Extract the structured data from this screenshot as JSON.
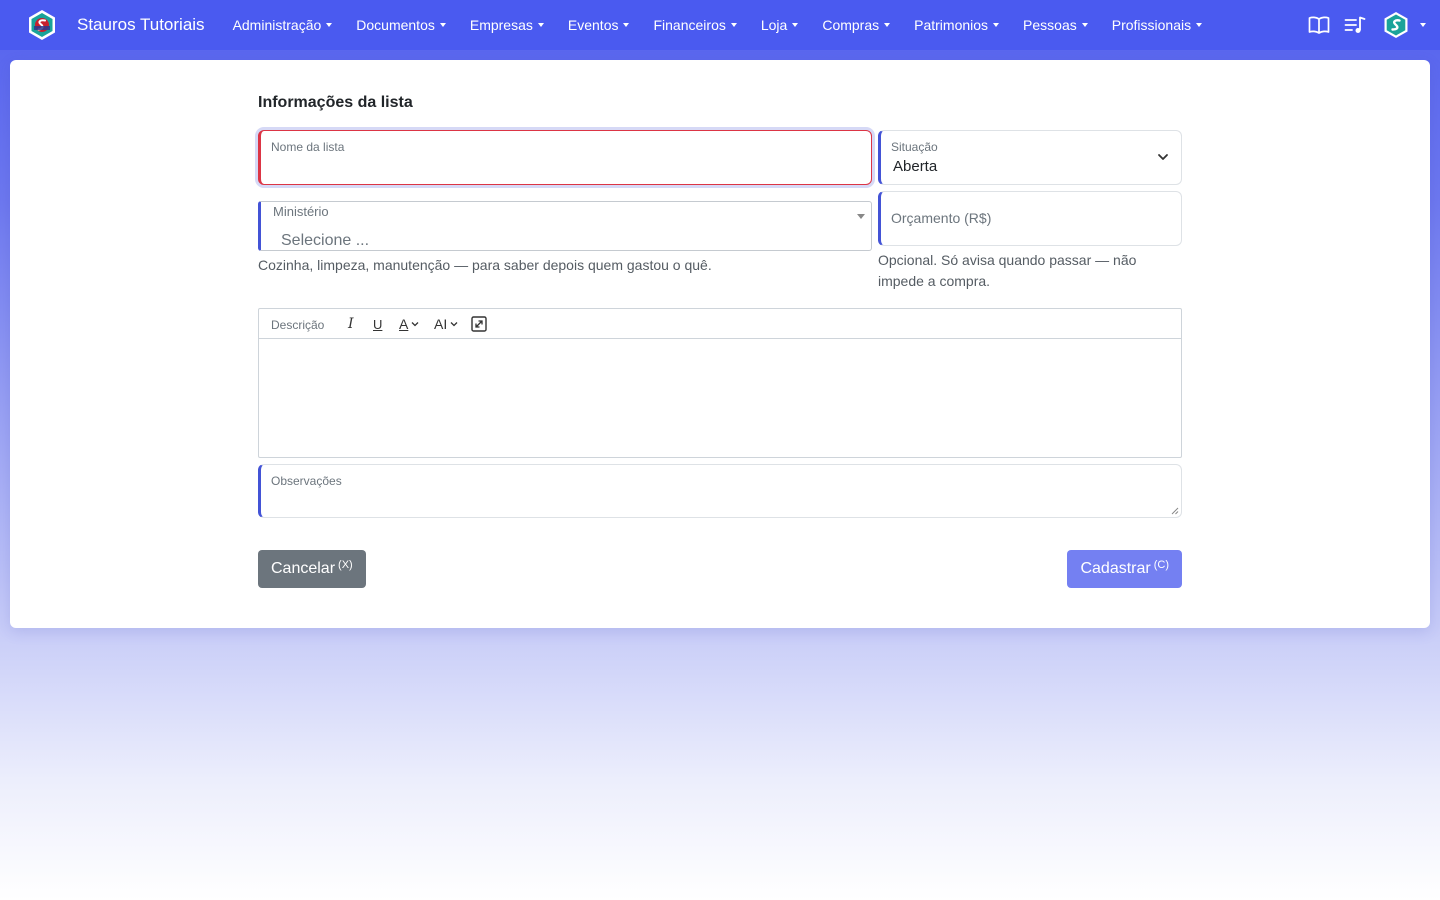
{
  "navbar": {
    "brand": "Stauros Tutoriais",
    "menu": [
      {
        "label": "Administração"
      },
      {
        "label": "Documentos"
      },
      {
        "label": "Empresas"
      },
      {
        "label": "Eventos"
      },
      {
        "label": "Financeiros"
      },
      {
        "label": "Loja"
      },
      {
        "label": "Compras"
      },
      {
        "label": "Patrimonios"
      },
      {
        "label": "Pessoas"
      },
      {
        "label": "Profissionais"
      }
    ],
    "icons": [
      "book-icon",
      "playlist-icon",
      "avatar-logo-icon"
    ]
  },
  "form": {
    "section_title": "Informações da lista",
    "nome": {
      "label": "Nome da lista",
      "value": ""
    },
    "situacao": {
      "label": "Situação",
      "value": "Aberta"
    },
    "ministerio": {
      "label": "Ministério",
      "placeholder": "Selecione ...",
      "help": "Cozinha, limpeza, manutenção — para saber depois quem gastou o quê."
    },
    "orcamento": {
      "placeholder": "Orçamento (R$)",
      "help": "Opcional. Só avisa quando passar — não impede a compra."
    },
    "descricao": {
      "label": "Descrição",
      "toolbar": {
        "italic": "I",
        "underline": "U",
        "color": "A",
        "size": "AI"
      }
    },
    "observacoes": {
      "label": "Observações"
    }
  },
  "actions": {
    "cancel": {
      "label": "Cancelar",
      "shortcut": "(X)"
    },
    "submit": {
      "label": "Cadastrar",
      "shortcut": "(C)"
    }
  },
  "colors": {
    "navbar": "#4a5af0",
    "accent": "#4353d6",
    "invalid": "#dc3545",
    "cancel_button": "#6c757d",
    "submit_button": "#7480f2",
    "logo": "#1aa39a"
  }
}
